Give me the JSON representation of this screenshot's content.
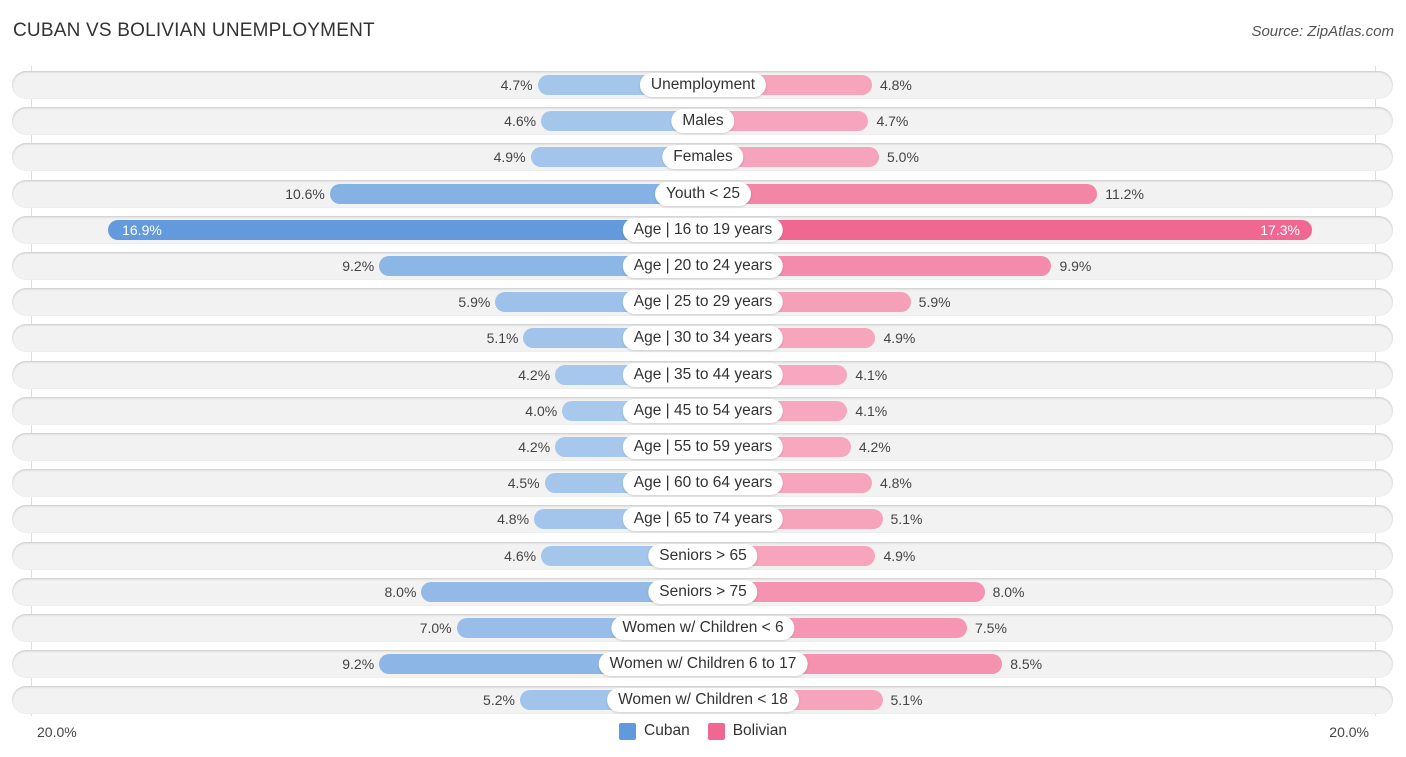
{
  "header": {
    "title": "CUBAN VS BOLIVIAN UNEMPLOYMENT",
    "source": "Source: ZipAtlas.com"
  },
  "colors": {
    "cuban_dark": "#6199dd",
    "cuban_light": "#a8c8ec",
    "bolivian_dark": "#f06792",
    "bolivian_light": "#f7a8c0",
    "row_bg": "#f2f2f2"
  },
  "chart_data": {
    "type": "bar",
    "orientation": "horizontal-diverging",
    "title": "CUBAN VS BOLIVIAN UNEMPLOYMENT",
    "categories": [
      "Unemployment",
      "Males",
      "Females",
      "Youth < 25",
      "Age | 16 to 19 years",
      "Age | 20 to 24 years",
      "Age | 25 to 29 years",
      "Age | 30 to 34 years",
      "Age | 35 to 44 years",
      "Age | 45 to 54 years",
      "Age | 55 to 59 years",
      "Age | 60 to 64 years",
      "Age | 65 to 74 years",
      "Seniors > 65",
      "Seniors > 75",
      "Women w/ Children < 6",
      "Women w/ Children 6 to 17",
      "Women w/ Children < 18"
    ],
    "series": [
      {
        "name": "Cuban",
        "side": "left",
        "values": [
          4.7,
          4.6,
          4.9,
          10.6,
          16.9,
          9.2,
          5.9,
          5.1,
          4.2,
          4.0,
          4.2,
          4.5,
          4.8,
          4.6,
          8.0,
          7.0,
          9.2,
          5.2
        ],
        "labels": [
          "4.7%",
          "4.6%",
          "4.9%",
          "10.6%",
          "16.9%",
          "9.2%",
          "5.9%",
          "5.1%",
          "4.2%",
          "4.0%",
          "4.2%",
          "4.5%",
          "4.8%",
          "4.6%",
          "8.0%",
          "7.0%",
          "9.2%",
          "5.2%"
        ]
      },
      {
        "name": "Bolivian",
        "side": "right",
        "values": [
          4.8,
          4.7,
          5.0,
          11.2,
          17.3,
          9.9,
          5.9,
          4.9,
          4.1,
          4.1,
          4.2,
          4.8,
          5.1,
          4.9,
          8.0,
          7.5,
          8.5,
          5.1
        ],
        "labels": [
          "4.8%",
          "4.7%",
          "5.0%",
          "11.2%",
          "17.3%",
          "9.9%",
          "5.9%",
          "4.9%",
          "4.1%",
          "4.1%",
          "4.2%",
          "4.8%",
          "5.1%",
          "4.9%",
          "8.0%",
          "7.5%",
          "8.5%",
          "5.1%"
        ]
      }
    ],
    "unit": "%",
    "xlim": [
      -20,
      20
    ],
    "axis_labels": {
      "left": "20.0%",
      "right": "20.0%"
    },
    "legend": {
      "position": "bottom-center",
      "entries": [
        "Cuban",
        "Bolivian"
      ]
    },
    "grid": false
  }
}
